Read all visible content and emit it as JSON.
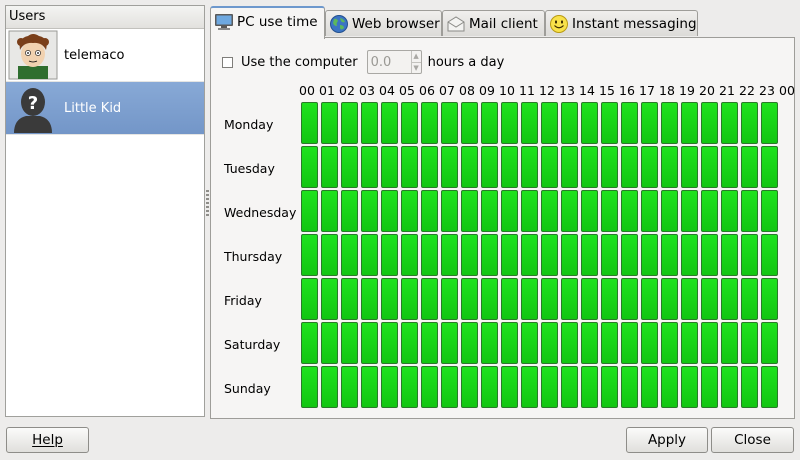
{
  "users_panel": {
    "header": "Users",
    "users": [
      {
        "name": "telemaco",
        "icon": "cartoon-boy-avatar-icon",
        "selected": false
      },
      {
        "name": "Little Kid",
        "icon": "unknown-person-avatar-icon",
        "selected": true
      }
    ]
  },
  "tabs": [
    {
      "label": "PC use time",
      "icon": "monitor-icon",
      "active": true
    },
    {
      "label": "Web browser",
      "icon": "globe-icon",
      "active": false
    },
    {
      "label": "Mail client",
      "icon": "envelope-icon",
      "active": false
    },
    {
      "label": "Instant messaging",
      "icon": "smiley-icon",
      "active": false
    }
  ],
  "pc_use": {
    "checkbox_label": "Use the computer",
    "checkbox_checked": false,
    "hours_value": "0.0",
    "hours_suffix": "hours a day"
  },
  "schedule": {
    "hours": [
      "00",
      "01",
      "02",
      "03",
      "04",
      "05",
      "06",
      "07",
      "08",
      "09",
      "10",
      "11",
      "12",
      "13",
      "14",
      "15",
      "16",
      "17",
      "18",
      "19",
      "20",
      "21",
      "22",
      "23",
      "00"
    ],
    "days": [
      "Monday",
      "Tuesday",
      "Wednesday",
      "Thursday",
      "Friday",
      "Saturday",
      "Sunday"
    ],
    "cell_state": "allowed",
    "allowed_color": "#1ed81e"
  },
  "buttons": {
    "help": "Help",
    "apply": "Apply",
    "close": "Close"
  }
}
